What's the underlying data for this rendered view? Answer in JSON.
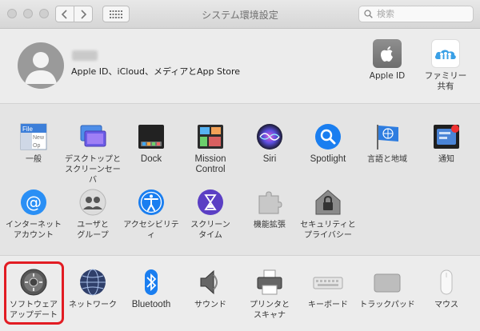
{
  "window": {
    "title": "システム環境設定"
  },
  "search": {
    "placeholder": "検索"
  },
  "account": {
    "name": "〇〇",
    "subtitle": "Apple ID、iCloud、メディアとApp Store",
    "icons": [
      {
        "label": "Apple ID",
        "icon": "apple-id-icon"
      },
      {
        "label": "ファミリー\n共有",
        "icon": "family-sharing-icon"
      }
    ]
  },
  "row1": [
    {
      "label": "一般",
      "icon": "general-icon"
    },
    {
      "label": "デスクトップと\nスクリーンセーバ",
      "icon": "desktop-screensaver-icon"
    },
    {
      "label": "Dock",
      "icon": "dock-icon"
    },
    {
      "label": "Mission\nControl",
      "icon": "mission-control-icon"
    },
    {
      "label": "Siri",
      "icon": "siri-icon"
    },
    {
      "label": "Spotlight",
      "icon": "spotlight-icon"
    },
    {
      "label": "言語と地域",
      "icon": "language-region-icon"
    },
    {
      "label": "通知",
      "icon": "notifications-icon"
    }
  ],
  "row2": [
    {
      "label": "インターネット\nアカウント",
      "icon": "internet-accounts-icon"
    },
    {
      "label": "ユーザと\nグループ",
      "icon": "users-groups-icon"
    },
    {
      "label": "アクセシビリティ",
      "icon": "accessibility-icon"
    },
    {
      "label": "スクリーン\nタイム",
      "icon": "screen-time-icon"
    },
    {
      "label": "機能拡張",
      "icon": "extensions-icon"
    },
    {
      "label": "セキュリティと\nプライバシー",
      "icon": "security-privacy-icon"
    }
  ],
  "row3": [
    {
      "label": "ソフトウェア\nアップデート",
      "icon": "software-update-icon"
    },
    {
      "label": "ネットワーク",
      "icon": "network-icon"
    },
    {
      "label": "Bluetooth",
      "icon": "bluetooth-icon"
    },
    {
      "label": "サウンド",
      "icon": "sound-icon"
    },
    {
      "label": "プリンタと\nスキャナ",
      "icon": "printers-scanners-icon"
    },
    {
      "label": "キーボード",
      "icon": "keyboard-icon"
    },
    {
      "label": "トラックパッド",
      "icon": "trackpad-icon"
    },
    {
      "label": "マウス",
      "icon": "mouse-icon"
    }
  ],
  "colors": {
    "highlight": "#e21c23",
    "blue": "#1a7ef0"
  }
}
